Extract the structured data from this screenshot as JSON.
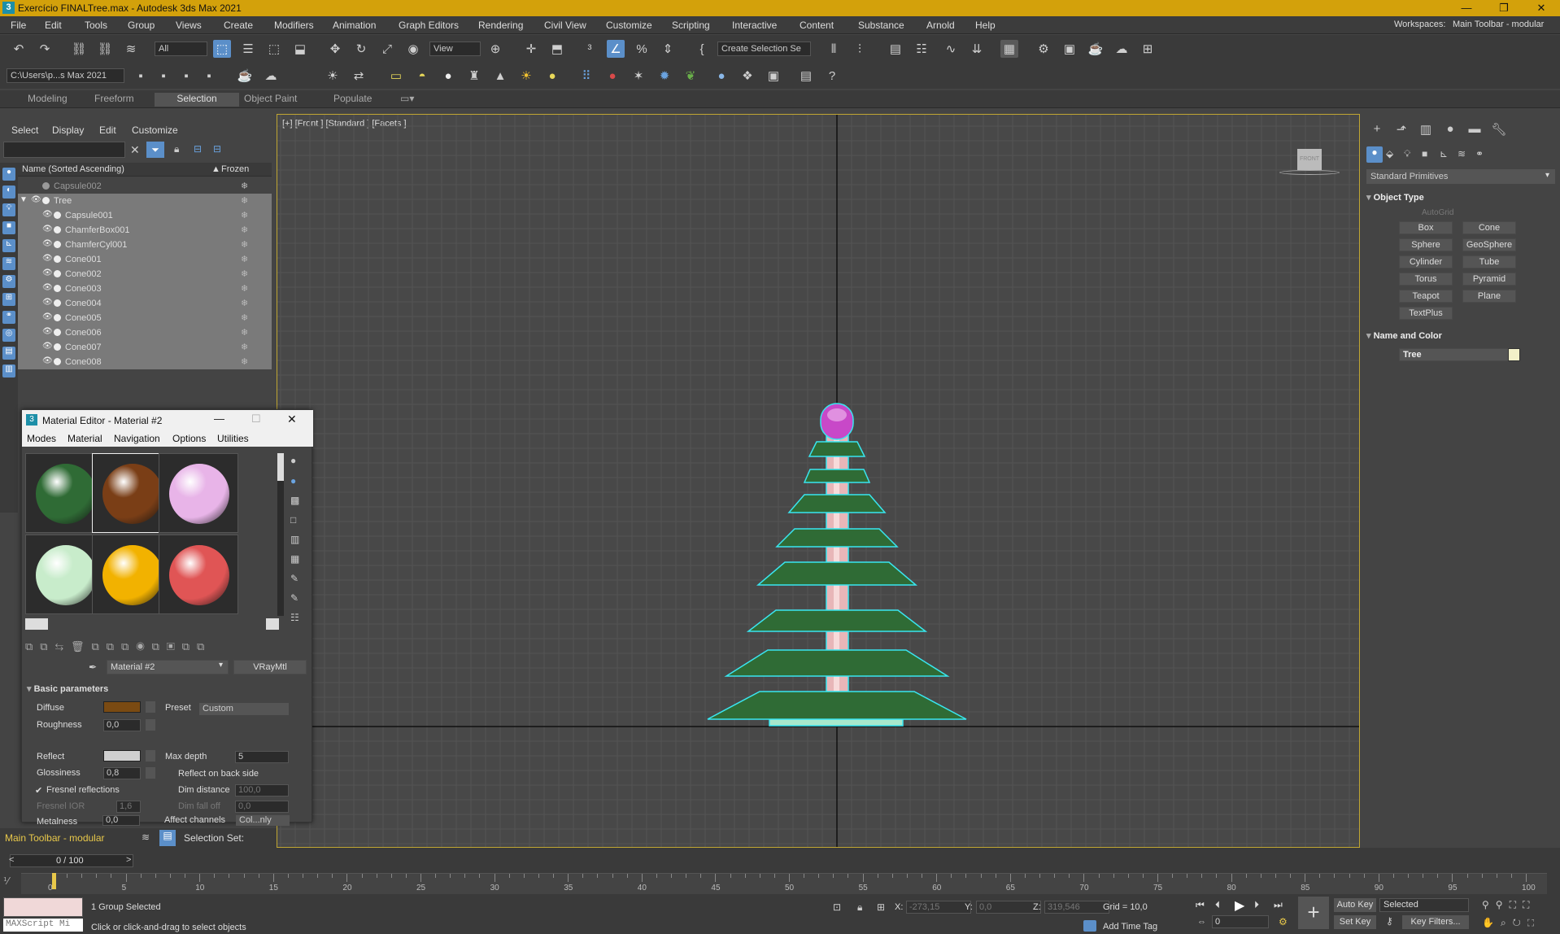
{
  "window": {
    "title": "Exercício FINALTree.max - Autodesk 3ds Max 2021",
    "app_icon": "3"
  },
  "menus": [
    "File",
    "Edit",
    "Tools",
    "Group",
    "Views",
    "Create",
    "Modifiers",
    "Animation",
    "Graph Editors",
    "Rendering",
    "Civil View",
    "Customize",
    "Scripting",
    "Interactive",
    "Content",
    "Substance",
    "Arnold",
    "Help"
  ],
  "workspace": {
    "label": "Workspaces:",
    "value": "Main Toolbar - modular"
  },
  "toolbar": {
    "filter": "All",
    "ref_coord": "View",
    "named_sel": "Create Selection Se",
    "project_path": "C:\\Users\\p...s Max 2021"
  },
  "ribbon_tabs": [
    "Modeling",
    "Freeform",
    "Selection",
    "Object Paint",
    "Populate"
  ],
  "ribbon_active": "Selection",
  "scene_explorer": {
    "menus": [
      "Select",
      "Display",
      "Edit",
      "Customize"
    ],
    "col_name": "Name (Sorted Ascending)",
    "col_frozen": "Frozen",
    "rows": [
      {
        "name": "Capsule002",
        "indent": 0
      },
      {
        "name": "Tree",
        "indent": 0
      },
      {
        "name": "Capsule001",
        "indent": 1
      },
      {
        "name": "ChamferBox001",
        "indent": 1
      },
      {
        "name": "ChamferCyl001",
        "indent": 1
      },
      {
        "name": "Cone001",
        "indent": 1
      },
      {
        "name": "Cone002",
        "indent": 1
      },
      {
        "name": "Cone003",
        "indent": 1
      },
      {
        "name": "Cone004",
        "indent": 1
      },
      {
        "name": "Cone005",
        "indent": 1
      },
      {
        "name": "Cone006",
        "indent": 1
      },
      {
        "name": "Cone007",
        "indent": 1
      },
      {
        "name": "Cone008",
        "indent": 1
      }
    ]
  },
  "viewport": {
    "label": "[+] [Front ] [Standard ] [Facets ]",
    "cube_label": "FRONT"
  },
  "command_panel": {
    "category": "Standard Primitives",
    "object_type_title": "Object Type",
    "autogrid": "AutoGrid",
    "buttons": [
      "Box",
      "Cone",
      "Sphere",
      "GeoSphere",
      "Cylinder",
      "Tube",
      "Torus",
      "Pyramid",
      "Teapot",
      "Plane",
      "TextPlus"
    ],
    "name_color_title": "Name and Color",
    "object_name": "Tree",
    "object_color": "#f2f0c8"
  },
  "material_editor": {
    "title": "Material Editor - Material #2",
    "menus": [
      "Modes",
      "Material",
      "Navigation",
      "Options",
      "Utilities"
    ],
    "slots": [
      "#2f6b35",
      "#7a3e16",
      "#e8b4e8",
      "#c8eccb",
      "#f2b200",
      "#e05555"
    ],
    "material_name": "Material #2",
    "material_type": "VRayMtl",
    "rollout": "Basic parameters",
    "diffuse_label": "Diffuse",
    "diffuse_color": "#7a4a12",
    "preset_label": "Preset",
    "preset_value": "Custom",
    "roughness_label": "Roughness",
    "roughness_value": "0,0",
    "reflect_label": "Reflect",
    "reflect_color": "#cfcfcf",
    "max_depth_label": "Max depth",
    "max_depth_value": "5",
    "glossiness_label": "Glossiness",
    "glossiness_value": "0,8",
    "reflect_back_label": "Reflect on back side",
    "fresnel_label": "Fresnel reflections",
    "dim_distance_label": "Dim distance",
    "dim_distance_value": "100,0",
    "fresnel_ior_label": "Fresnel IOR",
    "fresnel_ior_value": "1,6",
    "dim_falloff_label": "Dim fall off",
    "dim_falloff_value": "0,0",
    "metalness_label": "Metalness",
    "metalness_value": "0,0",
    "affect_label": "Affect channels",
    "affect_value": "Col...nly"
  },
  "bottom": {
    "workspace_small": "Main Toolbar - modular",
    "selection_set": "Selection Set:",
    "frame": "0 / 100",
    "ticks": [
      0,
      5,
      10,
      15,
      20,
      25,
      30,
      35,
      40,
      45,
      50,
      55,
      60,
      65,
      70,
      75,
      80,
      85,
      90,
      95,
      100
    ],
    "status_line1": "1 Group Selected",
    "status_line2": "Click or click-and-drag to select objects",
    "maxscript": "MAXScript Mi",
    "x_label": "X:",
    "x_value": "-273,15",
    "y_label": "Y:",
    "y_value": "0,0",
    "z_label": "Z:",
    "z_value": "319,546",
    "grid": "Grid = 10,0",
    "add_time_tag": "Add Time Tag",
    "auto_key": "Auto Key",
    "set_key": "Set Key",
    "selected": "Selected",
    "key_filters": "Key Filters...",
    "current_frame": "0"
  }
}
